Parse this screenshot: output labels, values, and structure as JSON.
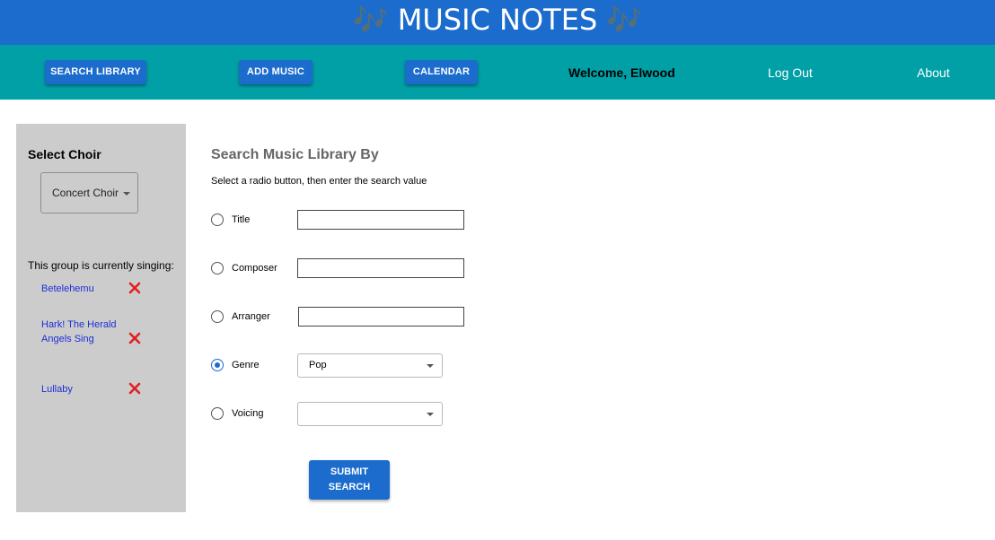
{
  "header": {
    "title": "🎶 MUSIC NOTES 🎶"
  },
  "nav": {
    "search_library": "SEARCH LIBRARY",
    "add_music": "ADD MUSIC",
    "calendar": "CALENDAR",
    "welcome": "Welcome, Elwood",
    "log_out": "Log Out",
    "about": "About"
  },
  "sidebar": {
    "select_choir_heading": "Select Choir",
    "choir_selected": "Concert Choir",
    "currently_singing_label": "This group is currently singing:",
    "songs": [
      {
        "title": "Betelehemu"
      },
      {
        "title": "Hark! The Herald Angels Sing"
      },
      {
        "title": "Lullaby"
      }
    ]
  },
  "search": {
    "heading": "Search Music Library By",
    "instructions": "Select a radio button, then enter the search value",
    "fields": [
      {
        "label": "Title",
        "value": "",
        "checked": false
      },
      {
        "label": "Composer",
        "value": "",
        "checked": false
      },
      {
        "label": "Arranger",
        "value": "",
        "checked": false
      },
      {
        "label": "Genre",
        "value": "Pop",
        "checked": true
      },
      {
        "label": "Voicing",
        "value": "",
        "checked": false
      }
    ],
    "submit_label": "SUBMIT SEARCH"
  },
  "colors": {
    "title_bar": "#1b6ccd",
    "nav_bar": "#00a0a6",
    "button": "#1b6ccd",
    "sidebar": "#cccccc",
    "link": "#1d2fd6",
    "remove_icon": "#e02020"
  }
}
